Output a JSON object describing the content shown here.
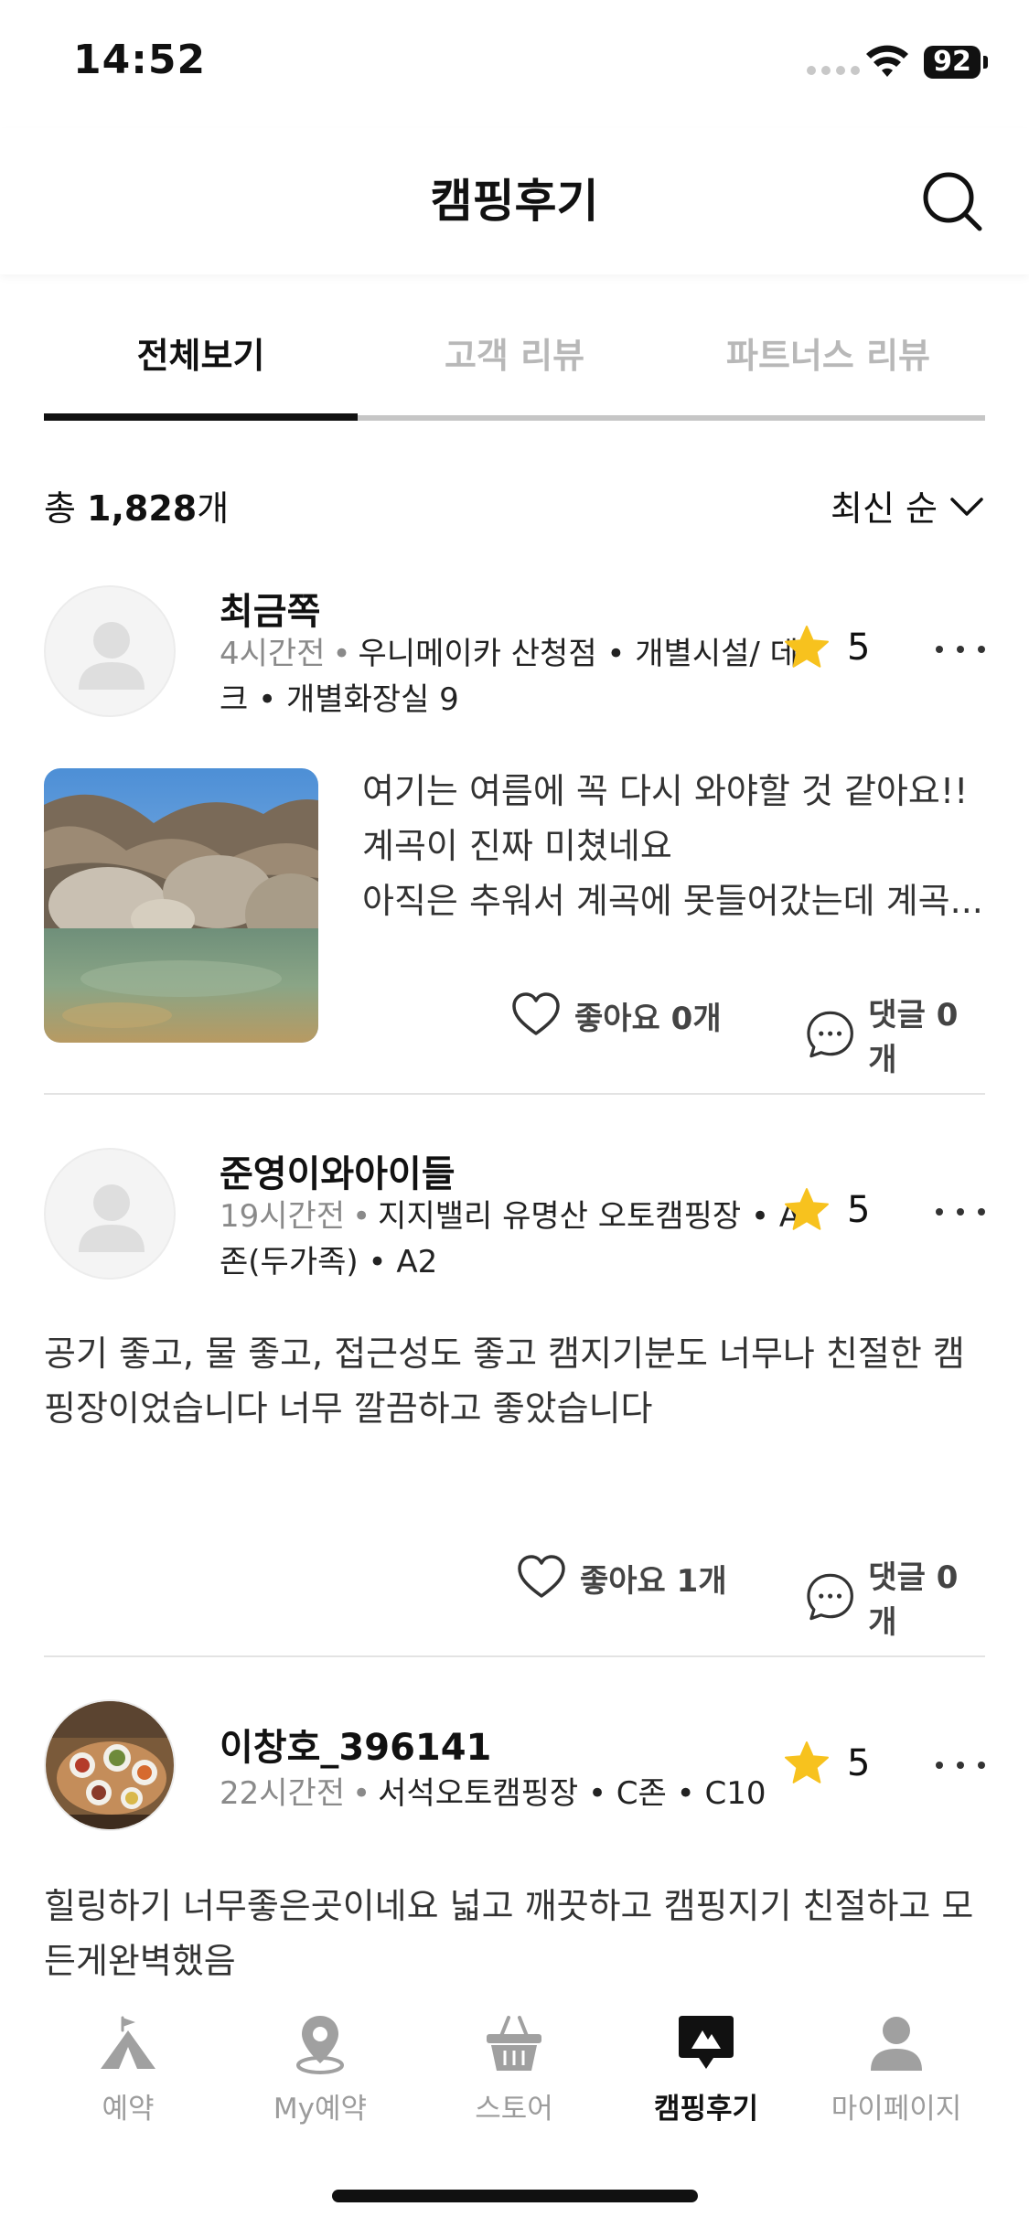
{
  "status_bar": {
    "time": "14:52",
    "battery": "92"
  },
  "header": {
    "title": "캠핑후기"
  },
  "tabs": [
    {
      "label": "전체보기",
      "active": true
    },
    {
      "label": "고객 리뷰",
      "active": false
    },
    {
      "label": "파트너스 리뷰",
      "active": false
    }
  ],
  "summary": {
    "prefix": "총 ",
    "count": "1,828",
    "suffix": "개",
    "sort_label": "최신 순"
  },
  "posts": [
    {
      "user": "최금쪽",
      "time": "4시간전",
      "location": "우니메이카 산청점 • 개별시설/ 데크 • 개별화장실 9",
      "rating": "5",
      "text_lines": [
        "여기는 여름에 꼭 다시 와야할 것 같아요!!",
        "계곡이 진짜 미쳤네요",
        "아직은 추워서 계곡에 못들어갔는데 계곡..."
      ],
      "like_label": "좋아요 0개",
      "comment_label": "댓글 0개"
    },
    {
      "user": "준영이와아이들",
      "time": "19시간전",
      "location": "지지밸리 유명산 오토캠핑장 • A존(두가족) • A2",
      "rating": "5",
      "text_lines": [
        "공기 좋고, 물 좋고, 접근성도 좋고 캠지기분도 너무나 친절한 캠",
        "핑장이었습니다 너무 깔끔하고 좋았습니다"
      ],
      "like_label": "좋아요 1개",
      "comment_label": "댓글 0개"
    },
    {
      "user": "이창호_396141",
      "time": "22시간전",
      "location": "서석오토캠핑장 • C존 • C10",
      "rating": "5",
      "text_lines": [
        "힐링하기 너무좋은곳이네요 넓고 깨끗하고 캠핑지기 친절하고 모",
        "든게완벽했음"
      ]
    }
  ],
  "bottom_nav": [
    {
      "label": "예약",
      "icon": "camping-tent-icon",
      "active": false
    },
    {
      "label": "My예약",
      "icon": "location-pin-icon",
      "active": false
    },
    {
      "label": "스토어",
      "icon": "shopping-basket-icon",
      "active": false
    },
    {
      "label": "캠핑후기",
      "icon": "review-chat-icon",
      "active": true
    },
    {
      "label": "마이페이지",
      "icon": "person-icon",
      "active": false
    }
  ],
  "colors": {
    "accent_star": "#F7C21E",
    "active_text": "#111111",
    "inactive_text": "#B8B8B8"
  }
}
